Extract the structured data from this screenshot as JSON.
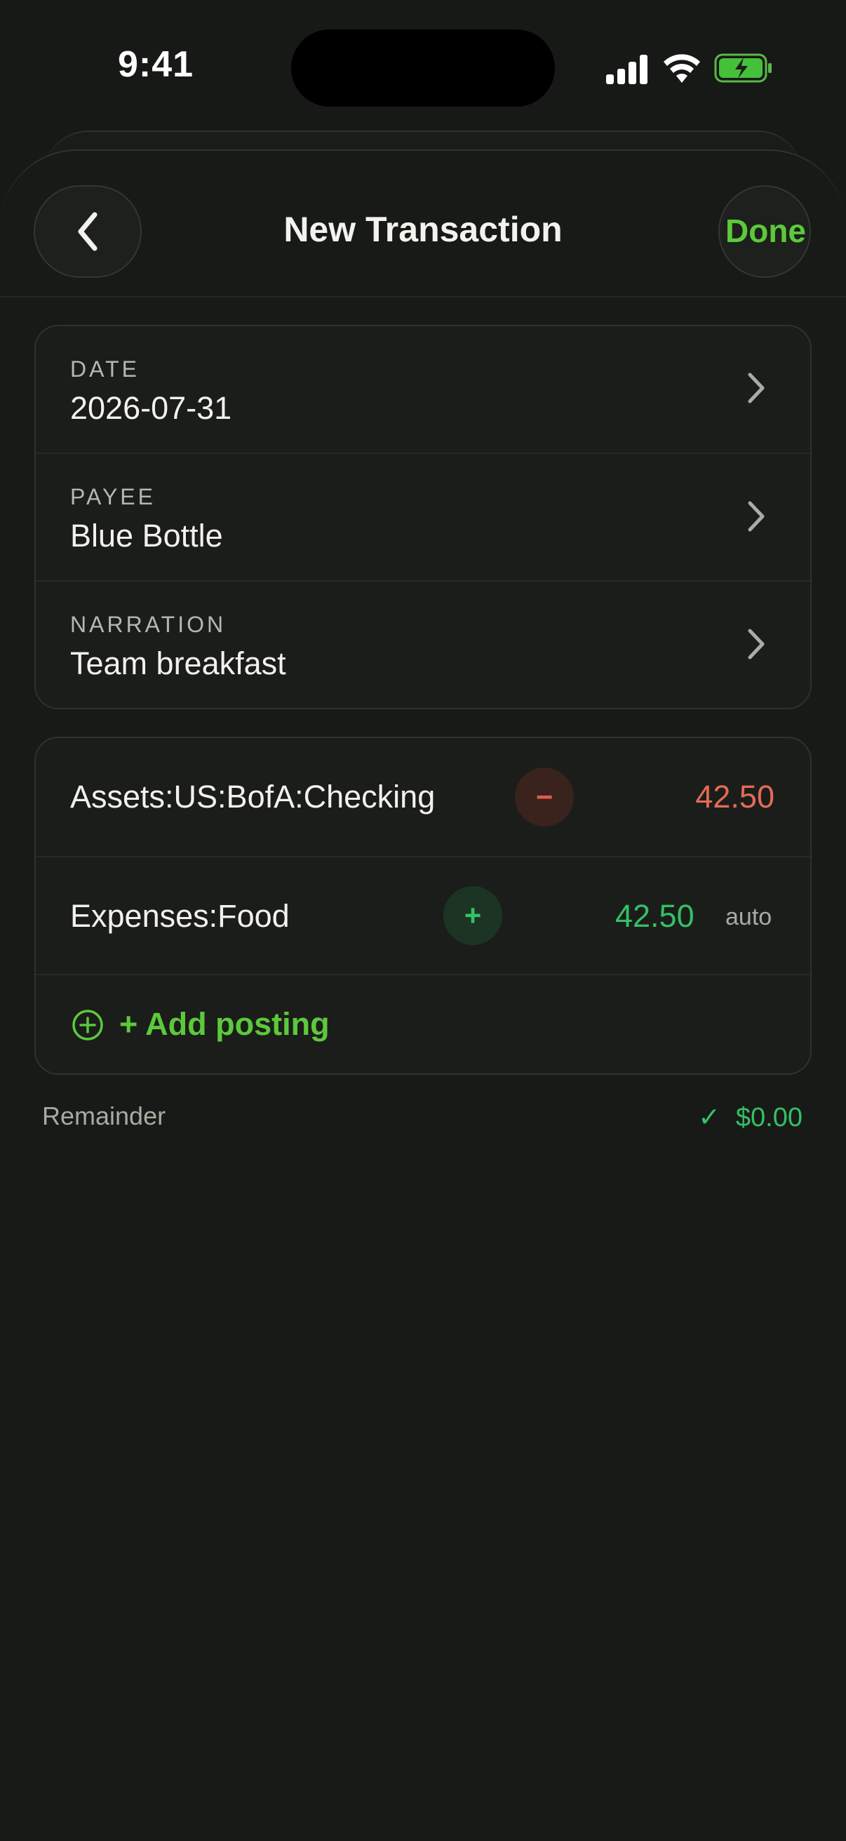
{
  "status": {
    "time": "9:41"
  },
  "nav": {
    "title": "New Transaction",
    "done_label": "Done"
  },
  "fields": [
    {
      "label": "DATE",
      "value": "2026-07-31"
    },
    {
      "label": "PAYEE",
      "value": "Blue Bottle"
    },
    {
      "label": "NARRATION",
      "value": "Team breakfast"
    }
  ],
  "postings": [
    {
      "account": "Assets:US:BofA:Checking",
      "sign": "−",
      "amount": "42.50",
      "tag": ""
    },
    {
      "account": "Expenses:Food",
      "sign": "+",
      "amount": "42.50",
      "tag": "auto"
    }
  ],
  "add_posting_label": "+ Add posting",
  "remainder": {
    "label": "Remainder",
    "check": "✓",
    "value": "$0.00"
  },
  "colors": {
    "accent_green": "#5cc93b",
    "positive": "#34c067",
    "negative": "#e66a56",
    "background": "#171916"
  }
}
